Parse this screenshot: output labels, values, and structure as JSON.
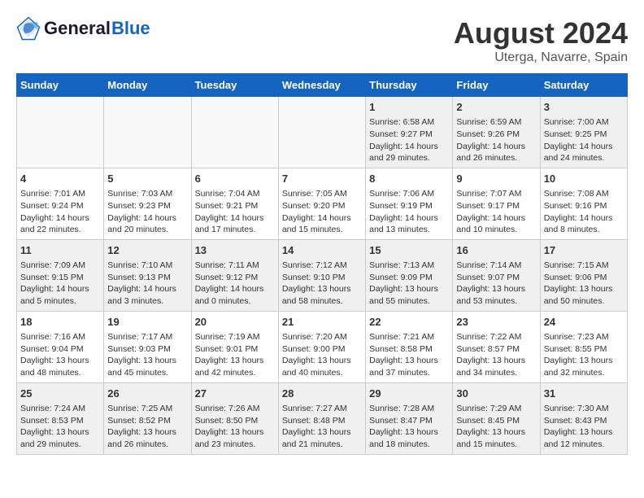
{
  "header": {
    "logo_line1": "General",
    "logo_line2": "Blue",
    "title": "August 2024",
    "subtitle": "Uterga, Navarre, Spain"
  },
  "weekdays": [
    "Sunday",
    "Monday",
    "Tuesday",
    "Wednesday",
    "Thursday",
    "Friday",
    "Saturday"
  ],
  "weeks": [
    [
      {
        "day": "",
        "info": ""
      },
      {
        "day": "",
        "info": ""
      },
      {
        "day": "",
        "info": ""
      },
      {
        "day": "",
        "info": ""
      },
      {
        "day": "1",
        "info": "Sunrise: 6:58 AM\nSunset: 9:27 PM\nDaylight: 14 hours\nand 29 minutes."
      },
      {
        "day": "2",
        "info": "Sunrise: 6:59 AM\nSunset: 9:26 PM\nDaylight: 14 hours\nand 26 minutes."
      },
      {
        "day": "3",
        "info": "Sunrise: 7:00 AM\nSunset: 9:25 PM\nDaylight: 14 hours\nand 24 minutes."
      }
    ],
    [
      {
        "day": "4",
        "info": "Sunrise: 7:01 AM\nSunset: 9:24 PM\nDaylight: 14 hours\nand 22 minutes."
      },
      {
        "day": "5",
        "info": "Sunrise: 7:03 AM\nSunset: 9:23 PM\nDaylight: 14 hours\nand 20 minutes."
      },
      {
        "day": "6",
        "info": "Sunrise: 7:04 AM\nSunset: 9:21 PM\nDaylight: 14 hours\nand 17 minutes."
      },
      {
        "day": "7",
        "info": "Sunrise: 7:05 AM\nSunset: 9:20 PM\nDaylight: 14 hours\nand 15 minutes."
      },
      {
        "day": "8",
        "info": "Sunrise: 7:06 AM\nSunset: 9:19 PM\nDaylight: 14 hours\nand 13 minutes."
      },
      {
        "day": "9",
        "info": "Sunrise: 7:07 AM\nSunset: 9:17 PM\nDaylight: 14 hours\nand 10 minutes."
      },
      {
        "day": "10",
        "info": "Sunrise: 7:08 AM\nSunset: 9:16 PM\nDaylight: 14 hours\nand 8 minutes."
      }
    ],
    [
      {
        "day": "11",
        "info": "Sunrise: 7:09 AM\nSunset: 9:15 PM\nDaylight: 14 hours\nand 5 minutes."
      },
      {
        "day": "12",
        "info": "Sunrise: 7:10 AM\nSunset: 9:13 PM\nDaylight: 14 hours\nand 3 minutes."
      },
      {
        "day": "13",
        "info": "Sunrise: 7:11 AM\nSunset: 9:12 PM\nDaylight: 14 hours\nand 0 minutes."
      },
      {
        "day": "14",
        "info": "Sunrise: 7:12 AM\nSunset: 9:10 PM\nDaylight: 13 hours\nand 58 minutes."
      },
      {
        "day": "15",
        "info": "Sunrise: 7:13 AM\nSunset: 9:09 PM\nDaylight: 13 hours\nand 55 minutes."
      },
      {
        "day": "16",
        "info": "Sunrise: 7:14 AM\nSunset: 9:07 PM\nDaylight: 13 hours\nand 53 minutes."
      },
      {
        "day": "17",
        "info": "Sunrise: 7:15 AM\nSunset: 9:06 PM\nDaylight: 13 hours\nand 50 minutes."
      }
    ],
    [
      {
        "day": "18",
        "info": "Sunrise: 7:16 AM\nSunset: 9:04 PM\nDaylight: 13 hours\nand 48 minutes."
      },
      {
        "day": "19",
        "info": "Sunrise: 7:17 AM\nSunset: 9:03 PM\nDaylight: 13 hours\nand 45 minutes."
      },
      {
        "day": "20",
        "info": "Sunrise: 7:19 AM\nSunset: 9:01 PM\nDaylight: 13 hours\nand 42 minutes."
      },
      {
        "day": "21",
        "info": "Sunrise: 7:20 AM\nSunset: 9:00 PM\nDaylight: 13 hours\nand 40 minutes."
      },
      {
        "day": "22",
        "info": "Sunrise: 7:21 AM\nSunset: 8:58 PM\nDaylight: 13 hours\nand 37 minutes."
      },
      {
        "day": "23",
        "info": "Sunrise: 7:22 AM\nSunset: 8:57 PM\nDaylight: 13 hours\nand 34 minutes."
      },
      {
        "day": "24",
        "info": "Sunrise: 7:23 AM\nSunset: 8:55 PM\nDaylight: 13 hours\nand 32 minutes."
      }
    ],
    [
      {
        "day": "25",
        "info": "Sunrise: 7:24 AM\nSunset: 8:53 PM\nDaylight: 13 hours\nand 29 minutes."
      },
      {
        "day": "26",
        "info": "Sunrise: 7:25 AM\nSunset: 8:52 PM\nDaylight: 13 hours\nand 26 minutes."
      },
      {
        "day": "27",
        "info": "Sunrise: 7:26 AM\nSunset: 8:50 PM\nDaylight: 13 hours\nand 23 minutes."
      },
      {
        "day": "28",
        "info": "Sunrise: 7:27 AM\nSunset: 8:48 PM\nDaylight: 13 hours\nand 21 minutes."
      },
      {
        "day": "29",
        "info": "Sunrise: 7:28 AM\nSunset: 8:47 PM\nDaylight: 13 hours\nand 18 minutes."
      },
      {
        "day": "30",
        "info": "Sunrise: 7:29 AM\nSunset: 8:45 PM\nDaylight: 13 hours\nand 15 minutes."
      },
      {
        "day": "31",
        "info": "Sunrise: 7:30 AM\nSunset: 8:43 PM\nDaylight: 13 hours\nand 12 minutes."
      }
    ]
  ]
}
